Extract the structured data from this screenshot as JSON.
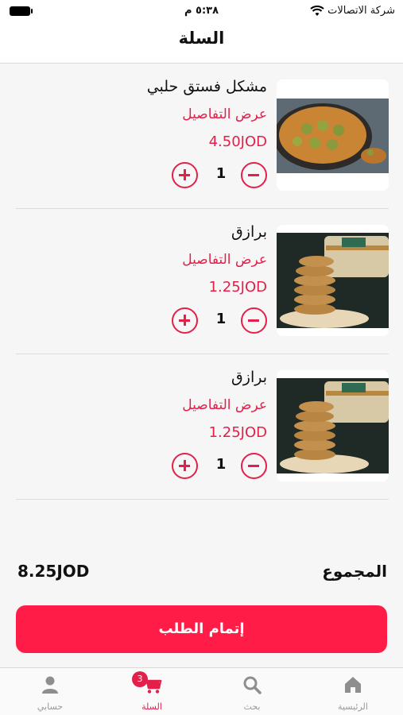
{
  "status_bar": {
    "carrier": "شركة الاتصالات",
    "time": "٥:٣٨ م"
  },
  "header": {
    "title": "السلة"
  },
  "cart": {
    "items": [
      {
        "name": "مشكل فستق حلبي",
        "details_link": "عرض التفاصيل",
        "price": "4.50JOD",
        "quantity": "1"
      },
      {
        "name": "برازق",
        "details_link": "عرض التفاصيل",
        "price": "1.25JOD",
        "quantity": "1"
      },
      {
        "name": "برازق",
        "details_link": "عرض التفاصيل",
        "price": "1.25JOD",
        "quantity": "1"
      }
    ],
    "total_label": "المجموع",
    "total_value": "8.25JOD",
    "checkout_label": "إتمام الطلب"
  },
  "tab_bar": {
    "tabs": [
      {
        "label": "الرئيسية",
        "icon": "home-icon"
      },
      {
        "label": "بحث",
        "icon": "search-icon"
      },
      {
        "label": "السلة",
        "icon": "cart-icon",
        "badge": "3"
      },
      {
        "label": "حسابي",
        "icon": "user-icon"
      }
    ]
  },
  "colors": {
    "accent": "#ff1d48",
    "price_text": "#e3204a"
  }
}
